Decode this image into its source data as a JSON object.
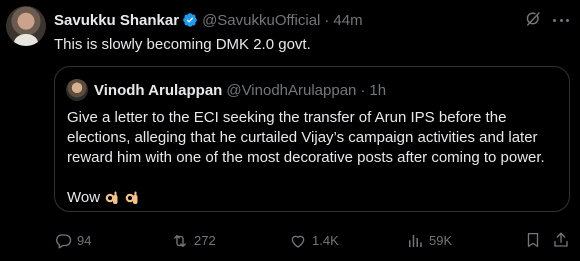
{
  "author": {
    "name": "Savukku Shankar",
    "handle": "@SavukkuOfficial",
    "separator": "·",
    "time": "44m"
  },
  "post_text": "This is slowly becoming DMK 2.0 govt.",
  "quote": {
    "name": "Vinodh Arulappan",
    "handle": "@VinodhArulappan",
    "separator": "·",
    "time": "1h",
    "lines": [
      "Give a letter to the ECI seeking the transfer of Arun IPS before the",
      "elections, alleging that he curtailed Vijay’s campaign activities and later",
      "reward him with one of the most decorative posts after coming to power."
    ],
    "wow": "Wow"
  },
  "actions": {
    "replies": "94",
    "reposts": "272",
    "likes": "1.4K",
    "views": "59K"
  },
  "icons": [
    "verified-icon",
    "grok-icon",
    "more-icon",
    "ok-hand-emoji-icon",
    "reply-icon",
    "repost-icon",
    "like-icon",
    "views-icon",
    "bookmark-icon",
    "share-icon"
  ],
  "colors": {
    "background": "#000000",
    "text": "#e7e9ea",
    "muted": "#71767b",
    "verified": "#1d9bf0",
    "border": "#2f3336"
  }
}
